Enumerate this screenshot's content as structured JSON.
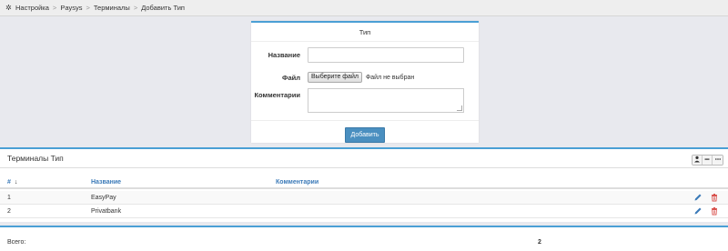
{
  "breadcrumb": {
    "items": [
      "Настройка",
      "Paysys",
      "Терминалы",
      "Добавить Тип"
    ],
    "separator": ">"
  },
  "form": {
    "title": "Тип",
    "name_label": "Название",
    "name_value": "",
    "file_label": "Файл",
    "file_button": "Выберите файл",
    "file_status": "Файл не выбран",
    "comment_label": "Комментарии",
    "comment_value": "",
    "submit_label": "Добавить"
  },
  "list": {
    "title": "Терминалы Тип",
    "tools": [
      "user-icon",
      "minus-icon",
      "more-icon"
    ],
    "columns": [
      "#",
      "Название",
      "Комментарии"
    ],
    "rows": [
      {
        "id": "1",
        "name": "EasyPay",
        "comment": ""
      },
      {
        "id": "2",
        "name": "Privatbank",
        "comment": ""
      }
    ]
  },
  "totals": {
    "label": "Всего:",
    "value": "2"
  },
  "colors": {
    "accent": "#4a9fd5",
    "button": "#4a8fc0",
    "delete": "#d9534f",
    "edit": "#3b7ab8"
  }
}
